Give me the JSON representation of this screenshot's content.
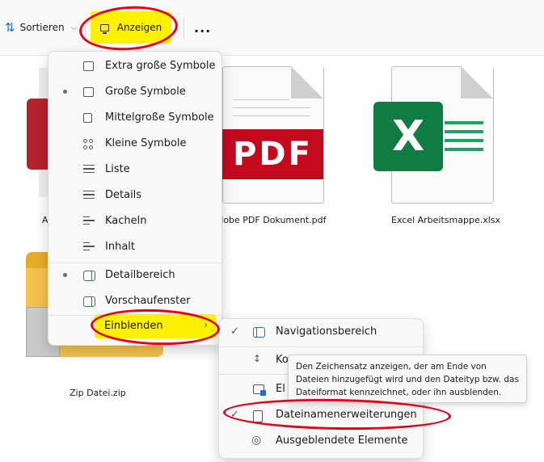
{
  "toolbar": {
    "sort_label": "Sortieren",
    "view_label": "Anzeigen",
    "more_label": "..."
  },
  "files": [
    {
      "name": "A",
      "icon": "red-document-icon"
    },
    {
      "name": "Adobe PDF Dokument.pdf",
      "icon": "pdf-icon",
      "badge": "PDF"
    },
    {
      "name": "Excel Arbeitsmappe.xlsx",
      "icon": "excel-icon",
      "badge": "X"
    },
    {
      "name": "Zip Datei.zip",
      "icon": "zip-folder-icon"
    }
  ],
  "view_menu": {
    "items": [
      {
        "label": "Extra große Symbole",
        "icon": "monitor-icon",
        "selected": false
      },
      {
        "label": "Große Symbole",
        "icon": "monitor-icon",
        "selected": true
      },
      {
        "label": "Mittelgroße Symbole",
        "icon": "monitor-small-icon",
        "selected": false
      },
      {
        "label": "Kleine Symbole",
        "icon": "small-icons-grid-icon",
        "selected": false
      },
      {
        "label": "Liste",
        "icon": "list-icon",
        "selected": false
      },
      {
        "label": "Details",
        "icon": "details-icon",
        "selected": false
      },
      {
        "label": "Kacheln",
        "icon": "tiles-icon",
        "selected": false
      },
      {
        "label": "Inhalt",
        "icon": "content-icon",
        "selected": false
      }
    ],
    "panes": [
      {
        "label": "Detailbereich",
        "icon": "details-pane-icon",
        "selected": true
      },
      {
        "label": "Vorschaufenster",
        "icon": "preview-pane-icon",
        "selected": false
      }
    ],
    "show_label": "Einblenden"
  },
  "show_submenu": {
    "items": [
      {
        "label": "Navigationsbereich",
        "checked": true,
        "icon": "navigation-pane-icon"
      },
      {
        "label": "Ko",
        "checked": false,
        "icon": "compact-view-icon"
      },
      {
        "label": "El",
        "checked": false,
        "icon": "item-checkbox-icon"
      },
      {
        "label": "Dateinamenerweiterungen",
        "checked": true,
        "icon": "file-extension-icon"
      },
      {
        "label": "Ausgeblendete Elemente",
        "checked": false,
        "icon": "eye-icon"
      }
    ]
  },
  "tooltip": {
    "text": "Den Zeichensatz anzeigen, der am Ende von Dateien hinzugefügt wird und den Dateityp bzw. das Dateiformat kennzeichnet, oder ihn ausblenden."
  },
  "colors": {
    "highlight": "#fff200",
    "annotation": "#e3001b",
    "accent": "#1f6fd1"
  }
}
